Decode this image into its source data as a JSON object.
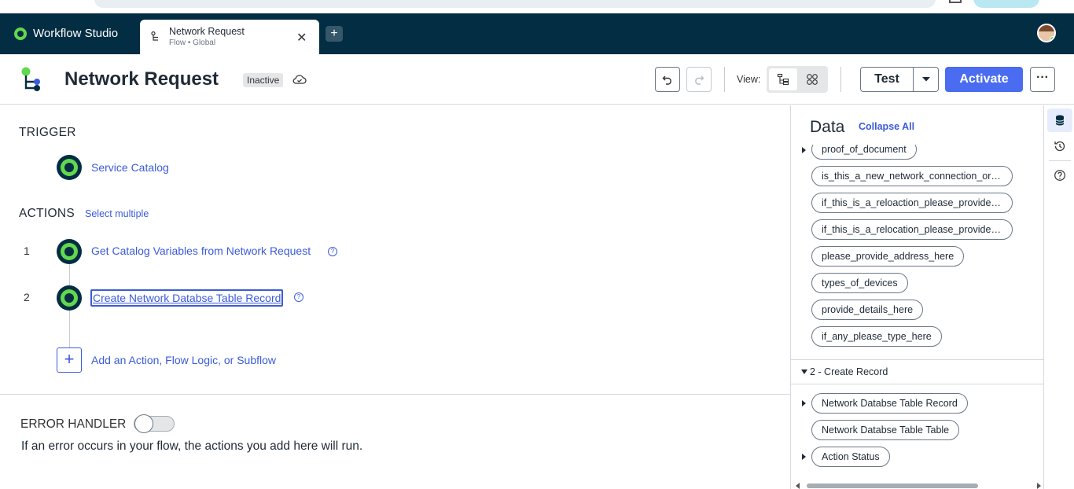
{
  "app": {
    "name": "Workflow Studio"
  },
  "tab": {
    "title": "Network Request",
    "subtitle": "Flow • Global",
    "new_tab_label": "+"
  },
  "flow": {
    "title": "Network Request",
    "status": "Inactive"
  },
  "toolbar": {
    "view_label": "View:",
    "test_label": "Test",
    "activate_label": "Activate",
    "more_label": "···"
  },
  "trigger": {
    "heading": "TRIGGER",
    "label": "Service Catalog"
  },
  "actions": {
    "heading": "ACTIONS",
    "select_multiple": "Select multiple",
    "items": [
      {
        "num": "1",
        "label": "Get Catalog Variables from Network Request"
      },
      {
        "num": "2",
        "label": "Create Network Databse Table Record"
      }
    ],
    "add_label": "Add an Action, Flow Logic, or Subflow"
  },
  "error_handler": {
    "heading": "ERROR HANDLER",
    "enabled": false,
    "description": "If an error occurs in your flow, the actions you add here will run."
  },
  "data_panel": {
    "title": "Data",
    "collapse_all": "Collapse All",
    "pills": [
      "proof_of_document",
      "is_this_a_new_network_connection_or_...",
      "if_this_is_a_reloaction_please_provide_...",
      "if_this_is_a_relocation_please_provide_...",
      "please_provide_address_here",
      "types_of_devices",
      "provide_details_here",
      "if_any_please_type_here"
    ],
    "group2": {
      "heading": "2 - Create Record",
      "pills": [
        "Network Databse Table Record",
        "Network Databse Table Table",
        "Action Status"
      ]
    }
  },
  "colors": {
    "header_bg": "#032d42",
    "accent": "#4a6cf0",
    "link": "#3b5bdb",
    "node_green": "#62d84e"
  }
}
